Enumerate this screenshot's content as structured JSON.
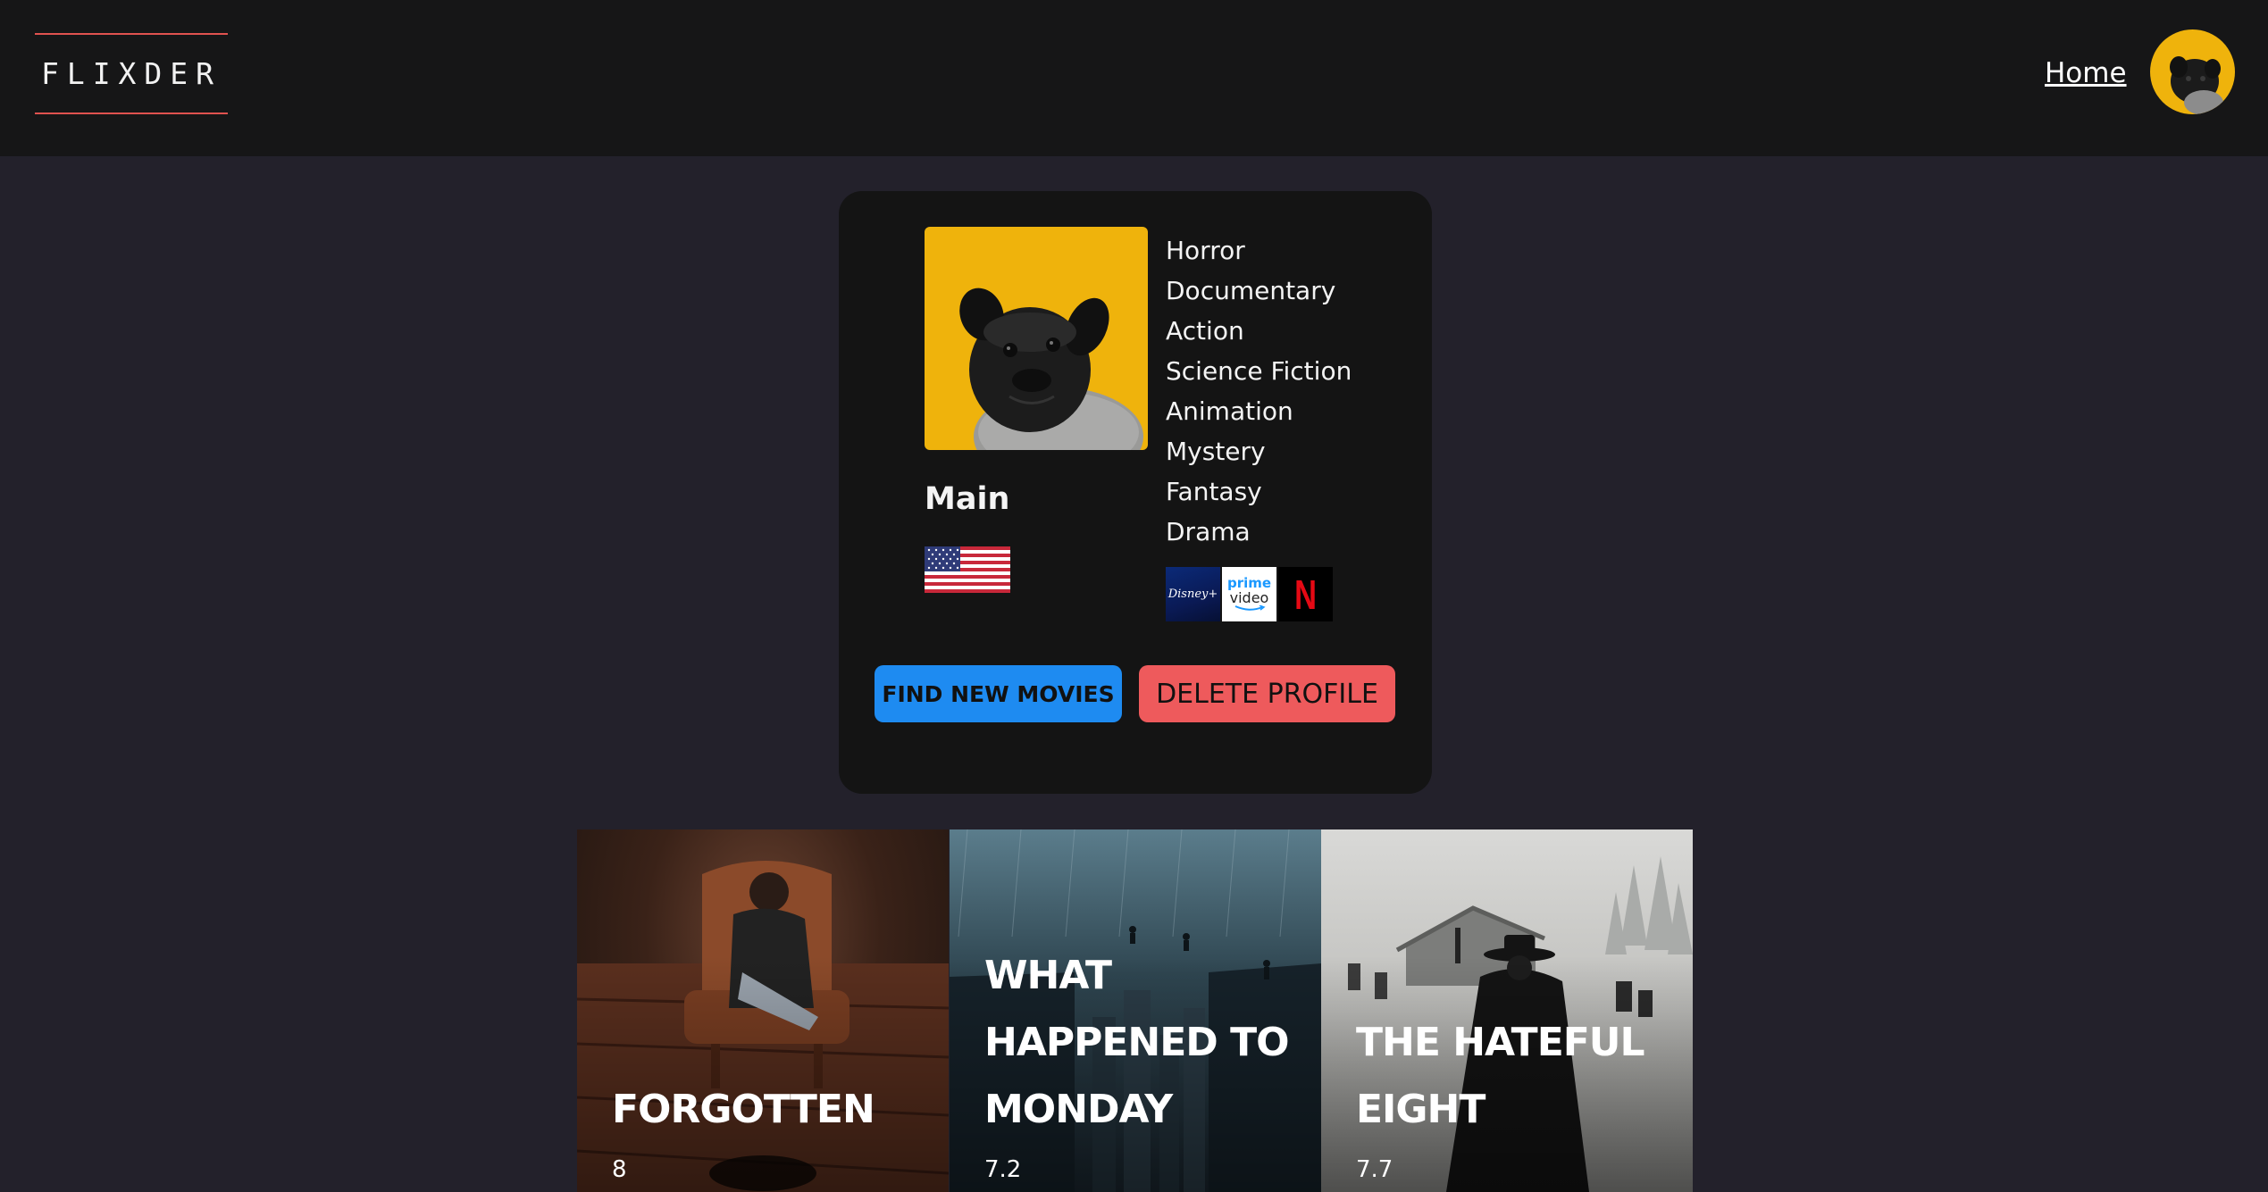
{
  "header": {
    "logo": "FLIXDER",
    "nav_home": "Home"
  },
  "profile": {
    "name": "Main",
    "country_flag": "flag-us",
    "genres": [
      "Horror",
      "Documentary",
      "Action",
      "Science Fiction",
      "Animation",
      "Mystery",
      "Fantasy",
      "Drama"
    ],
    "providers": [
      {
        "icon": "disney-plus-logo",
        "text": "Disney+"
      },
      {
        "icon": "prime-video-logo",
        "text_1": "prime",
        "text_2": "video"
      },
      {
        "icon": "netflix-logo",
        "text": "N"
      }
    ],
    "find_button": "FIND NEW MOVIES",
    "delete_button": "DELETE PROFILE"
  },
  "movies": [
    {
      "title": "FORGOTTEN",
      "rating": "8"
    },
    {
      "title": "WHAT HAPPENED TO MONDAY",
      "rating": "7.2"
    },
    {
      "title": "THE HATEFUL EIGHT",
      "rating": "7.7"
    }
  ],
  "colors": {
    "header_bg": "#161617",
    "page_bg": "#23212b",
    "card_bg": "#141414",
    "accent_red": "#e0524f",
    "find_button": "#1e8bf1",
    "delete_button": "#ee5a5c",
    "avatar_yellow": "#efb30c"
  }
}
